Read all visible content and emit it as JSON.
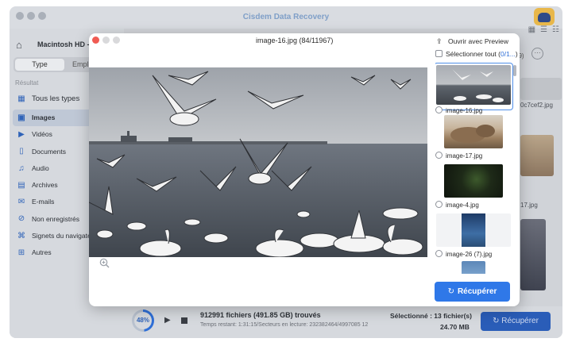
{
  "app": {
    "title": "Cisdem Data Recovery",
    "logo_icon": "owl-logo-icon"
  },
  "sidebar": {
    "disk_label": "Macintosh  HD -",
    "segment": {
      "type_label": "Type",
      "path_label_fragment": "Empl"
    },
    "result_label": "Résultat",
    "items": [
      {
        "label": "Tous les types",
        "icon": "grid-icon"
      },
      {
        "label": "Images",
        "icon": "image-icon"
      },
      {
        "label": "Vidéos",
        "icon": "video-icon"
      },
      {
        "label": "Documents",
        "icon": "document-icon"
      },
      {
        "label": "Audio",
        "icon": "music-icon"
      },
      {
        "label": "Archives",
        "icon": "archive-icon"
      },
      {
        "label": "E-mails",
        "icon": "mail-icon"
      },
      {
        "label": "Non enregistrés",
        "icon": "unsaved-icon"
      },
      {
        "label": "Signets du navigateur",
        "icon": "bookmark-icon"
      },
      {
        "label": "Autres",
        "icon": "other-icon"
      }
    ]
  },
  "content": {
    "count_fragment": "59)",
    "filename_fragment_1": "0c7cef2.jpg",
    "filename_fragment_2": "17.jpg"
  },
  "bottom_bar": {
    "progress": "48%",
    "progress_fraction": 0.48,
    "found": "912991 fichiers (491.85 GB) trouvés",
    "remaining": "Temps restant: 1:31:15/Secteurs en lecture: 232382464/4997085 12",
    "selected": "Sélectionné : 13 fichier(s)",
    "size": "24.70 MB",
    "recover_label": "Récupérer"
  },
  "preview": {
    "title": "image-16.jpg (84/11967)",
    "open_with_preview": "Ouvrir avec Preview",
    "select_all_label": "Sélectionner tout (",
    "select_all_count": "0/1...",
    "select_all_close": ")",
    "thumbnails": [
      {
        "label": "image-16.jpg",
        "selected": true
      },
      {
        "label": "image-17.jpg",
        "selected": false
      },
      {
        "label": "image-4.jpg",
        "selected": false
      },
      {
        "label": "image-26 (7).jpg",
        "selected": false
      }
    ],
    "recover_label": "Récupérer",
    "colors": {
      "accent": "#2f78e8",
      "selection_border": "#4f8ee8"
    }
  }
}
